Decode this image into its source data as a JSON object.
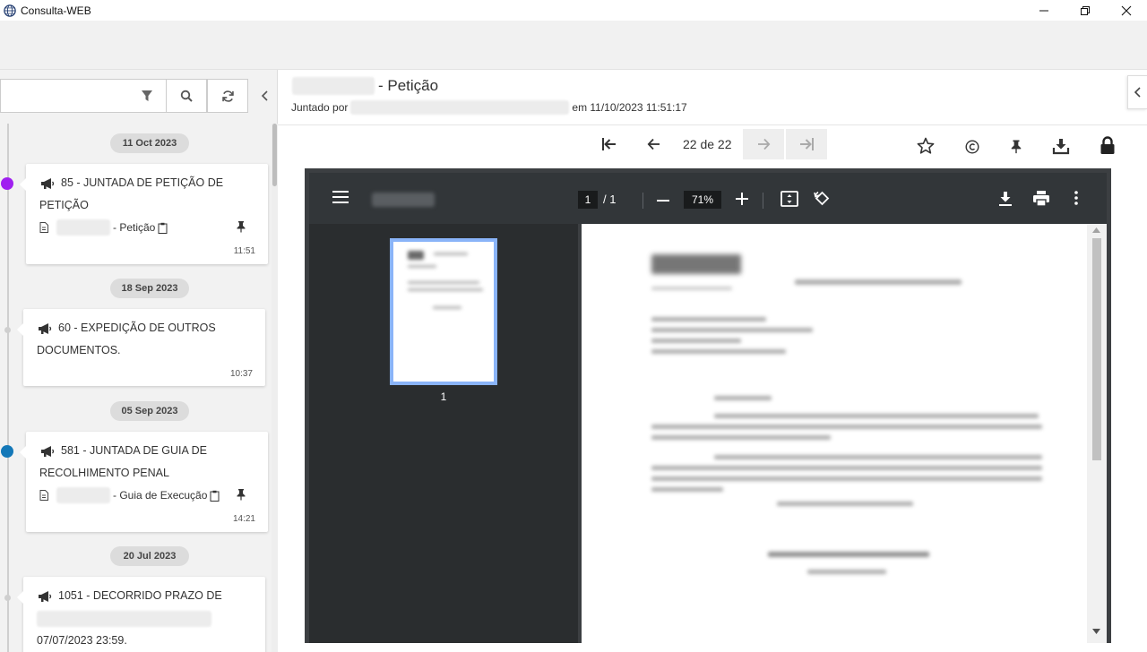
{
  "window": {
    "title": "Consulta-WEB",
    "icon": "globe-icon"
  },
  "timeline": {
    "items": [
      {
        "date": "11 Oct 2023",
        "title_line1": "85 - JUNTADA DE PETIÇÃO DE",
        "title_line2": "PETIÇÃO",
        "doc_label": "- Petição",
        "time": "11:51",
        "dot_color": "#a020f0"
      },
      {
        "date": "18 Sep 2023",
        "title_line1": "60 - EXPEDIÇÃO DE OUTROS",
        "title_line2": "DOCUMENTOS.",
        "time": "10:37",
        "dot_color": "#cfcfcf"
      },
      {
        "date": "05 Sep 2023",
        "title_line1": "581 - JUNTADA DE GUIA DE",
        "title_line2": "RECOLHIMENTO PENAL",
        "doc_label": "- Guia de Execução",
        "time": "14:21",
        "dot_color": "#1478b8"
      },
      {
        "date": "20 Jul 2023",
        "title_line1": "1051 - DECORRIDO PRAZO DE",
        "title_line3": "07/07/2023 23:59.",
        "dot_color": "#cfcfcf"
      }
    ]
  },
  "document": {
    "title": "- Petição",
    "juntado_por": "Juntado por",
    "em": "em 11/10/2023 11:51:17",
    "page_count": "22 de 22"
  },
  "pdf": {
    "page_current": "1",
    "page_total": "/ 1",
    "zoom": "71%",
    "thumb_number": "1"
  }
}
